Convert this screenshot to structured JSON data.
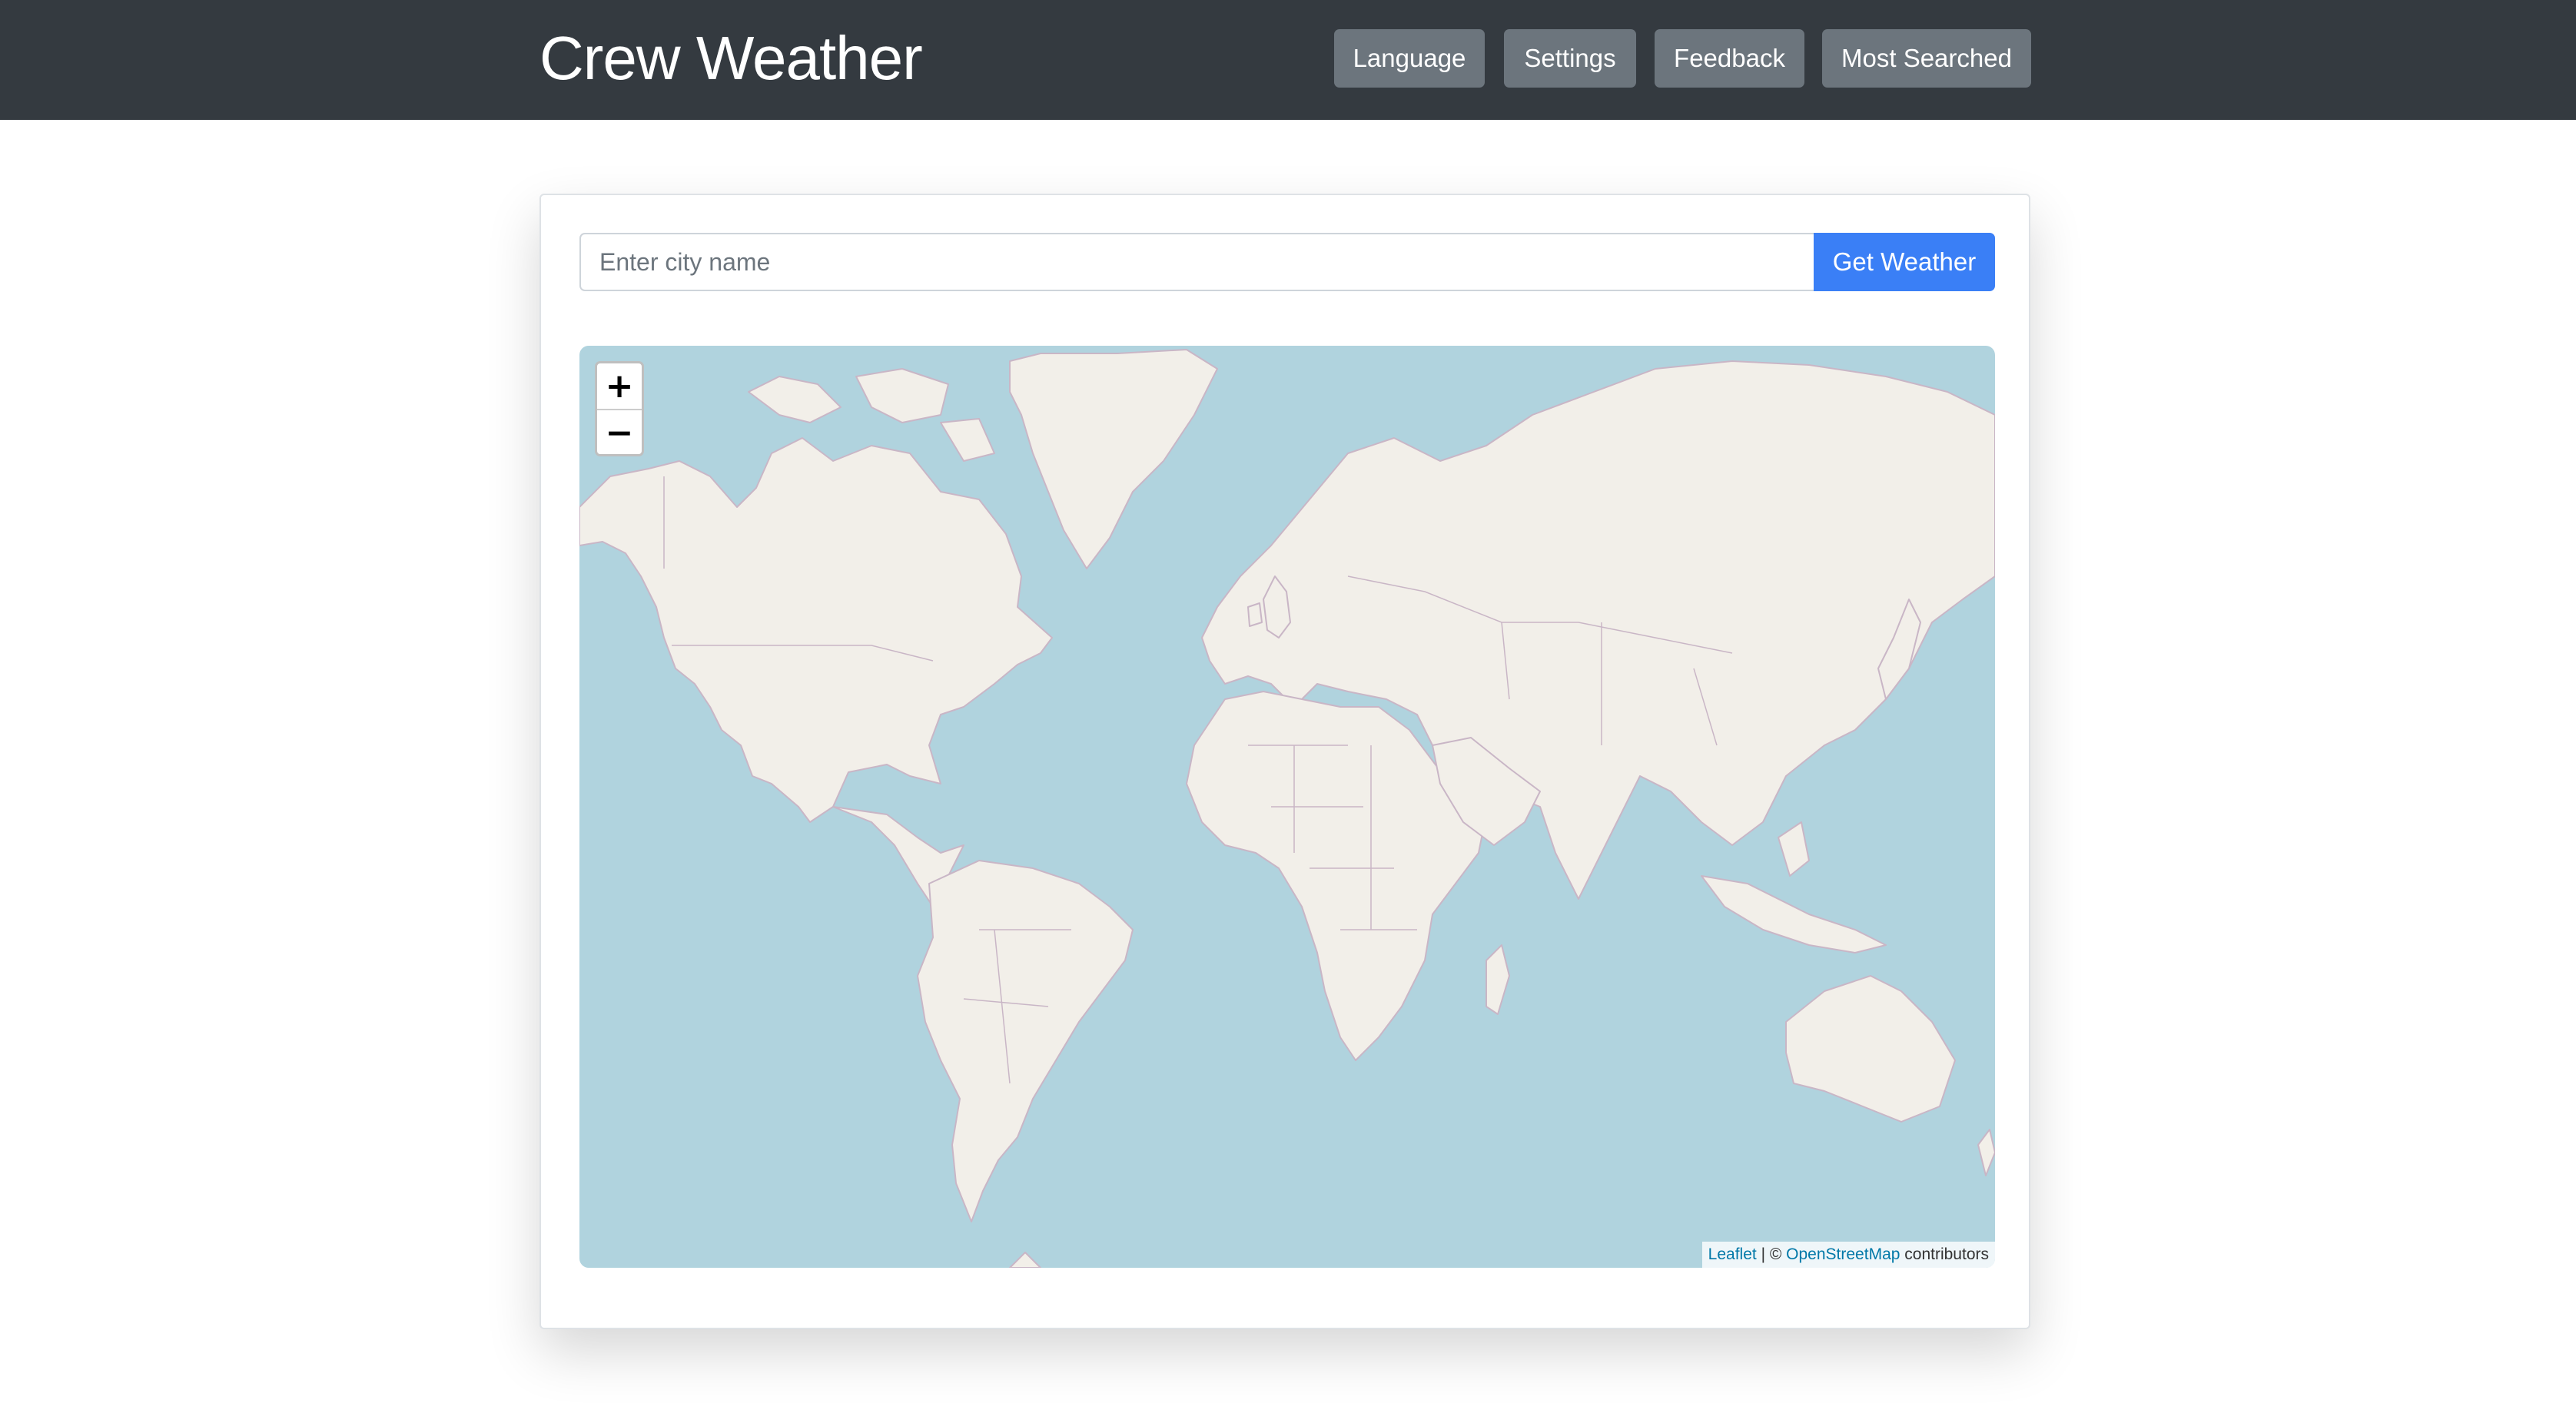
{
  "app": {
    "brand": "Crew Weather"
  },
  "nav": {
    "language": "Language",
    "settings": "Settings",
    "feedback": "Feedback",
    "most_searched": "Most Searched"
  },
  "search": {
    "placeholder": "Enter city name",
    "value": "",
    "button_label": "Get Weather"
  },
  "map": {
    "zoom_in": "+",
    "zoom_out": "−",
    "attribution": {
      "leaflet": "Leaflet",
      "separator": " | © ",
      "osm": "OpenStreetMap",
      "suffix": " contributors"
    }
  },
  "colors": {
    "navbar": "#343a40",
    "nav_button": "#6c757d",
    "primary": "#3a7ff6",
    "water": "#b0d3de",
    "land": "#f2efe9",
    "border": "#c9b6c6"
  },
  "icons": {
    "zoom_in": "plus-icon",
    "zoom_out": "minus-icon"
  }
}
